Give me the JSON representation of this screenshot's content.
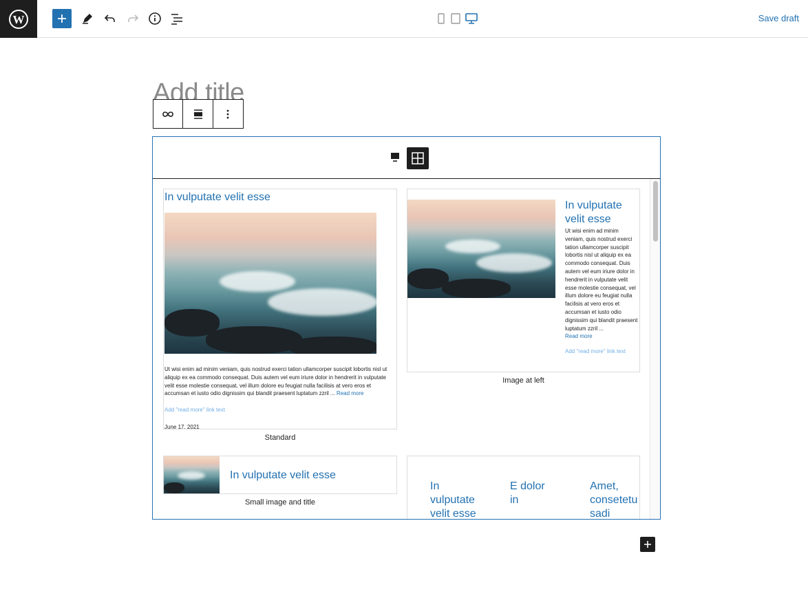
{
  "topbar": {
    "save_draft": "Save draft",
    "icons": [
      "wordpress-logo",
      "plus-icon",
      "pencil-icon",
      "undo-icon",
      "redo-icon",
      "info-icon",
      "list-view-icon",
      "mobile-icon",
      "tablet-icon",
      "desktop-icon"
    ]
  },
  "editor": {
    "title_placeholder": "Add title"
  },
  "block_toolbar": {
    "icons": [
      "link-icon",
      "align-icon",
      "more-options-icon"
    ]
  },
  "block": {
    "view_icons": [
      "preview-icon",
      "grid-icon"
    ],
    "cards": [
      {
        "title": "In vulputate velit esse",
        "excerpt": "Ut wisi enim ad minim veniam, quis nostrud exerci tation ullamcorper suscipit lobortis nisl ut aliquip ex ea commodo consequat. Duis autem vel eum iriure dolor in hendrerit in vulputate velit esse molestie consequat, vel illum dolore eu feugiat nulla facilisis at vero eros et accumsan et iusto odio dignissim qui blandit praesent luptatum zzril ...",
        "read_more": "Read more",
        "add_read_more": "Add \"read more\" link text",
        "date": "June 17, 2021",
        "caption": "Standard"
      },
      {
        "title": "In vulputate velit esse",
        "excerpt": "Ut wisi enim ad minim veniam, quis nostrud exerci tation ullamcorper suscipit lobortis nisl ut aliquip ex ea commodo consequat. Duis autem vel eum iriure dolor in hendrerit in vulputate velit esse molestie consequat, vel illum dolore eu feugiat nulla facilisis at vero eros et accumsan et iusto odio dignissim qui blandit praesent luptatum zzril ...",
        "read_more": "Read more",
        "add_read_more": "Add \"read more\" link text",
        "caption": "Image at left"
      },
      {
        "title": "In vulputate velit esse",
        "caption": "Small image and title"
      },
      {
        "columns": [
          "In vulputate velit esse",
          "E dolor in",
          "Amet, consetetu sadi"
        ]
      }
    ]
  }
}
